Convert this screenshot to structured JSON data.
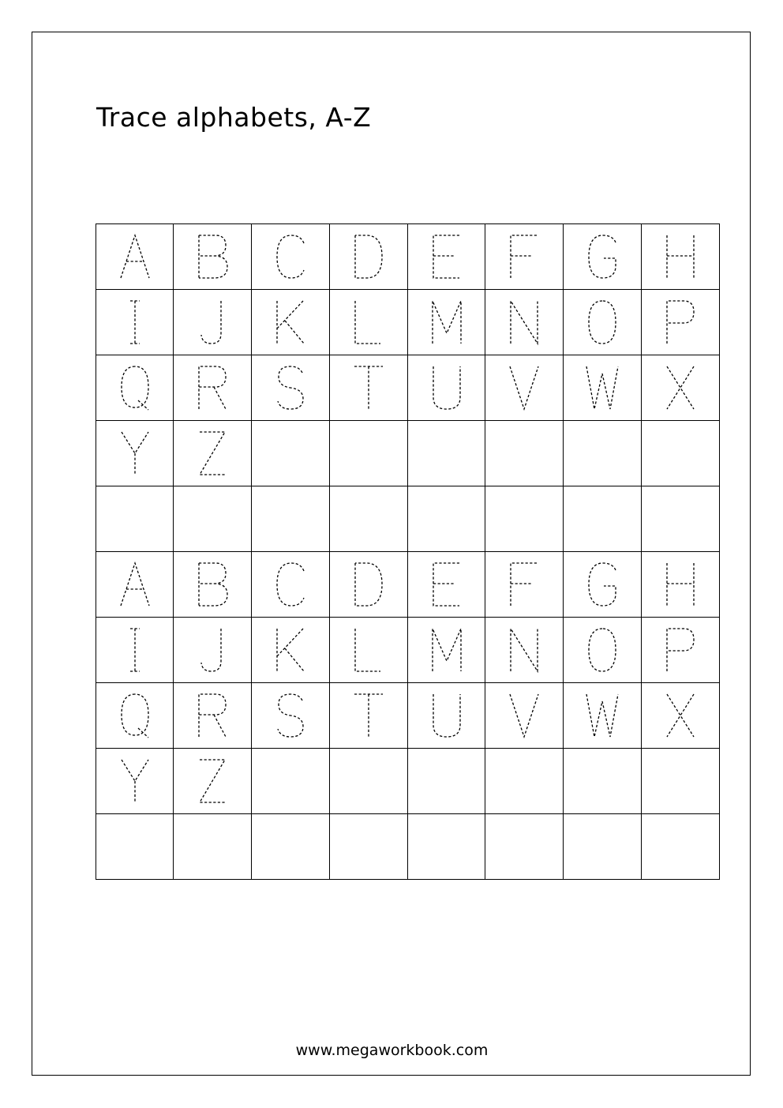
{
  "worksheet": {
    "title": "Trace alphabets, A-Z",
    "footer": "www.megaworkbook.com"
  },
  "tracing_grid": {
    "columns": 8,
    "rows": [
      [
        "A",
        "B",
        "C",
        "D",
        "E",
        "F",
        "G",
        "H"
      ],
      [
        "I",
        "J",
        "K",
        "L",
        "M",
        "N",
        "O",
        "P"
      ],
      [
        "Q",
        "R",
        "S",
        "T",
        "U",
        "V",
        "W",
        "X"
      ],
      [
        "Y",
        "Z",
        "",
        "",
        "",
        "",
        "",
        ""
      ],
      [
        "",
        "",
        "",
        "",
        "",
        "",
        "",
        ""
      ],
      [
        "A",
        "B",
        "C",
        "D",
        "E",
        "F",
        "G",
        "H"
      ],
      [
        "I",
        "J",
        "K",
        "L",
        "M",
        "N",
        "O",
        "P"
      ],
      [
        "Q",
        "R",
        "S",
        "T",
        "U",
        "V",
        "W",
        "X"
      ],
      [
        "Y",
        "Z",
        "",
        "",
        "",
        "",
        "",
        ""
      ],
      [
        "",
        "",
        "",
        "",
        "",
        "",
        "",
        ""
      ]
    ]
  },
  "style": {
    "ink_color": "#000000",
    "letter_style": "dashed-trace"
  }
}
